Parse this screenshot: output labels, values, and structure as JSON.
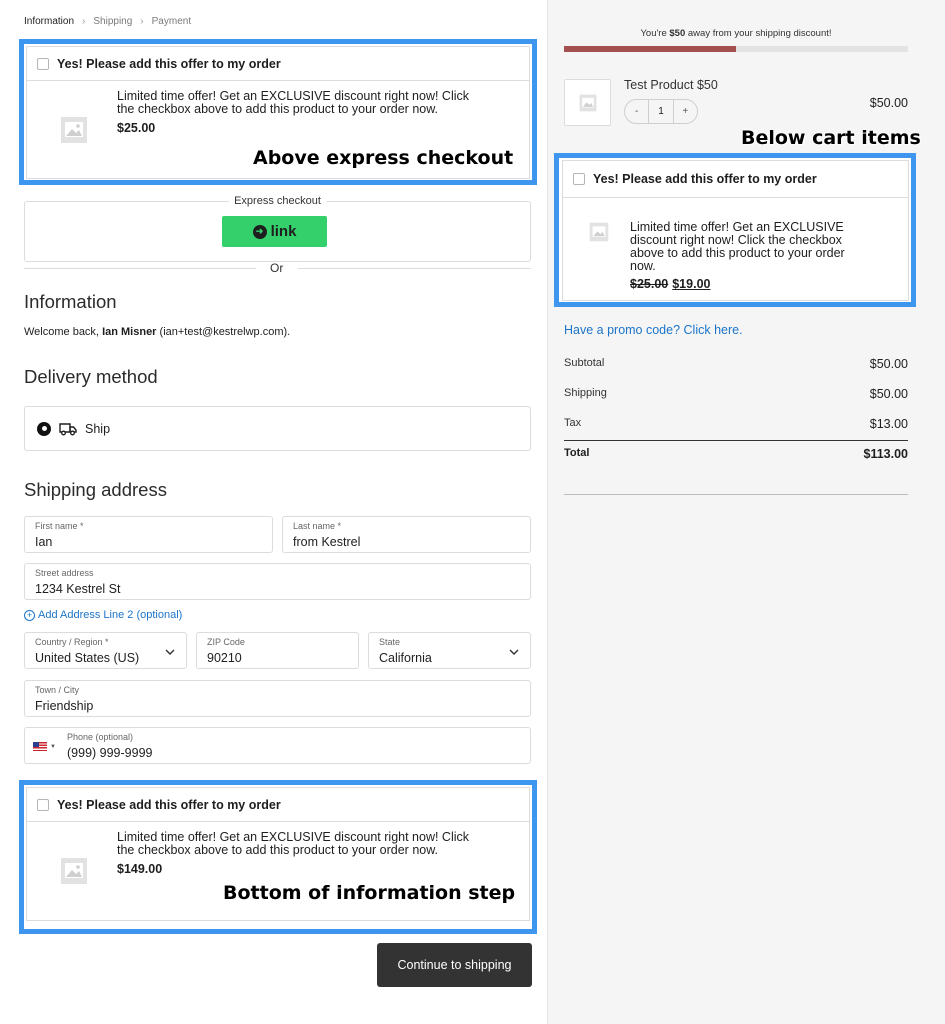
{
  "breadcrumb": {
    "step1": "Information",
    "step2": "Shipping",
    "step3": "Payment"
  },
  "offers": {
    "top": {
      "checkbox_label": "Yes! Please add this offer to my order",
      "line1": "Limited time offer! Get an EXCLUSIVE discount right now! Click",
      "line2": "the checkbox above to add this product to your order now.",
      "price": "$25.00",
      "caption": "Above express checkout"
    },
    "cart": {
      "checkbox_label": "Yes! Please add this offer to my order",
      "line1": "Limited time offer! Get an EXCLUSIVE",
      "line2": "discount right now! Click the checkbox",
      "line3": "above to add this product to your order",
      "line4": "now.",
      "old_price": "$25.00",
      "new_price": "$19.00",
      "caption": "Below cart items"
    },
    "bottom": {
      "checkbox_label": "Yes! Please add this offer to my order",
      "line1": "Limited time offer! Get an EXCLUSIVE discount right now! Click",
      "line2": "the checkbox above to add this product to your order now.",
      "price": "$149.00",
      "caption": "Bottom of information step"
    }
  },
  "express": {
    "label": "Express checkout",
    "link_label": "link",
    "or": "Or"
  },
  "information": {
    "heading": "Information",
    "welcome_prefix": "Welcome back, ",
    "user_name": "Ian Misner",
    "email_suffix": " (ian+test@kestrelwp.com)."
  },
  "delivery": {
    "heading": "Delivery method",
    "option": "Ship"
  },
  "shipping": {
    "heading": "Shipping address",
    "first_name": {
      "label": "First name *",
      "value": "Ian"
    },
    "last_name": {
      "label": "Last name *",
      "value": "from Kestrel"
    },
    "street": {
      "label": "Street address",
      "value": "1234 Kestrel St"
    },
    "add_line2": "Add Address Line 2 (optional)",
    "country": {
      "label": "Country / Region *",
      "value": "United States (US)"
    },
    "zip": {
      "label": "ZIP Code",
      "value": "90210"
    },
    "state": {
      "label": "State",
      "value": "California"
    },
    "city": {
      "label": "Town / City",
      "value": "Friendship"
    },
    "phone": {
      "label": "Phone (optional)",
      "value": "(999) 999-9999"
    }
  },
  "continue_label": "Continue to shipping",
  "cart": {
    "shipping_msg_prefix": "You're ",
    "shipping_msg_amount": "$50",
    "shipping_msg_suffix": " away from your shipping discount!",
    "progress_fraction": 0.5,
    "progress_color": "#a55050",
    "product_name": "Test Product $50",
    "qty_minus": "-",
    "qty_value": "1",
    "qty_plus": "+",
    "product_price": "$50.00",
    "promo": "Have a promo code? Click here."
  },
  "summary": {
    "subtotal_label": "Subtotal",
    "subtotal": "$50.00",
    "shipping_label": "Shipping",
    "shipping": "$50.00",
    "tax_label": "Tax",
    "tax": "$13.00",
    "total_label": "Total",
    "total": "$113.00"
  },
  "colors": {
    "annotation_frame": "#3f96ee",
    "link_button": "#33d06b",
    "accent_link": "#1c74c9"
  },
  "icons": [
    "chevron-right-icon",
    "image-placeholder-icon",
    "link-logo-icon",
    "truck-icon",
    "chevron-down-icon",
    "plus-circle-icon",
    "us-flag-icon"
  ]
}
